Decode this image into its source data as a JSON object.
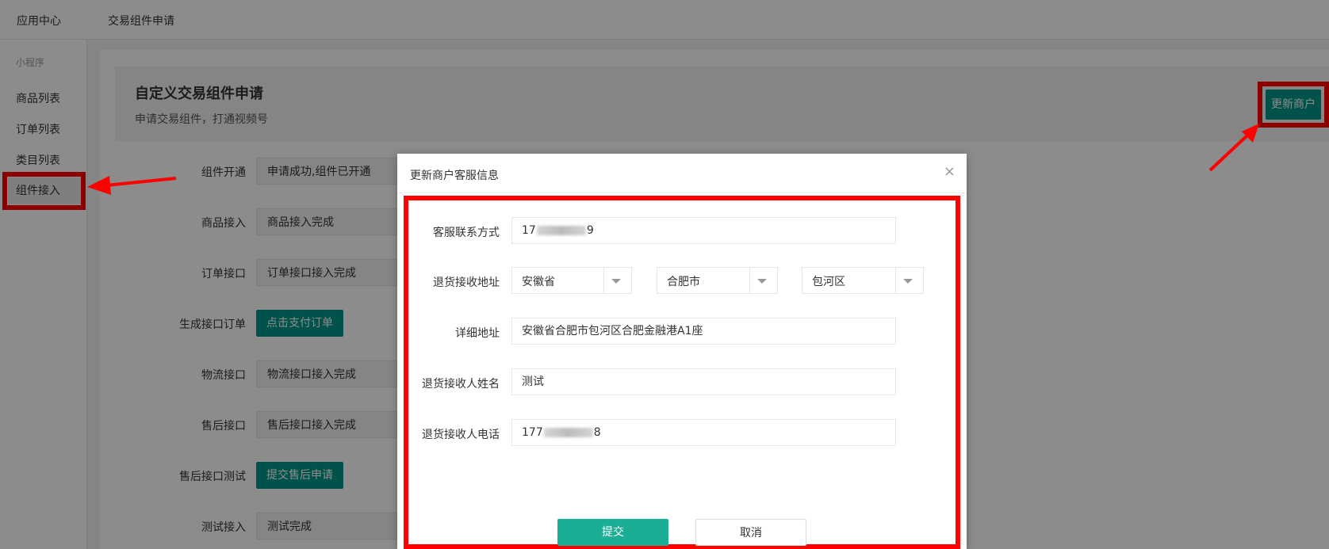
{
  "topbar": {
    "app_center": "应用中心",
    "page_tab": "交易组件申请"
  },
  "sidebar": {
    "group": "小程序",
    "items": [
      "商品列表",
      "订单列表",
      "类目列表",
      "组件接入"
    ]
  },
  "panel": {
    "title": "自定义交易组件申请",
    "subtitle": "申请交易组件，打通视频号"
  },
  "update_button": "更新商户",
  "form": [
    {
      "label": "组件开通",
      "value": "申请成功,组件已开通"
    },
    {
      "label": "商品接入",
      "value": "商品接入完成"
    },
    {
      "label": "订单接口",
      "value": "订单接口接入完成"
    },
    {
      "label": "生成接口订单",
      "button": "点击支付订单"
    },
    {
      "label": "物流接口",
      "value": "物流接口接入完成"
    },
    {
      "label": "售后接口",
      "value": "售后接口接入完成"
    },
    {
      "label": "售后接口测试",
      "button": "提交售后申请"
    },
    {
      "label": "测试接入",
      "value": "测试完成"
    }
  ],
  "dialog": {
    "title": "更新商户客服信息",
    "close": "×",
    "phone": {
      "label": "客服联系方式",
      "prefix": "17",
      "suffix": "9"
    },
    "address": {
      "label": "退货接收地址",
      "province": "安徽省",
      "city": "合肥市",
      "district": "包河区"
    },
    "detail": {
      "label": "详细地址",
      "value": "安徽省合肥市包河区合肥金融港A1座"
    },
    "receiver_name": {
      "label": "退货接收人姓名",
      "value": "测试"
    },
    "receiver_phone": {
      "label": "退货接收人电话",
      "prefix": "177",
      "suffix": "8"
    },
    "submit": "提交",
    "cancel": "取消"
  },
  "colors": {
    "accent": "#009688",
    "submit": "#1aae95",
    "highlight": "#ff0000"
  }
}
